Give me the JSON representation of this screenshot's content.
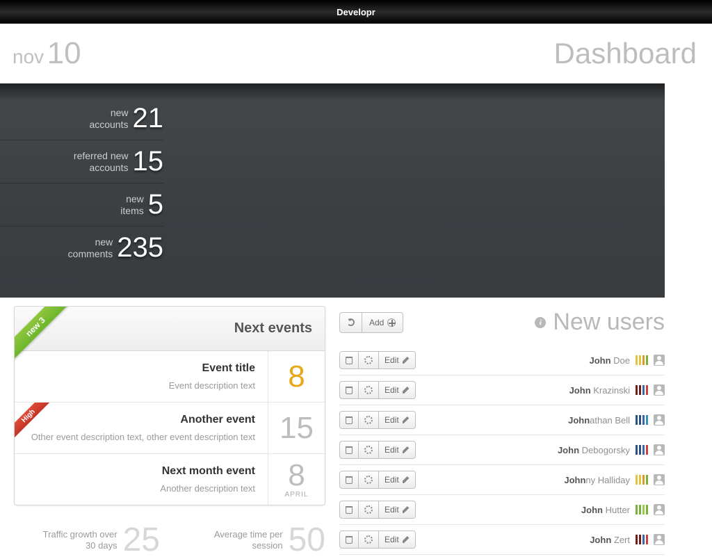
{
  "topbar": {
    "title": "Developr"
  },
  "header": {
    "month": "nov",
    "day": "10",
    "title": "Dashboard"
  },
  "stats": [
    {
      "label1": "new",
      "label2": "accounts",
      "value": "21"
    },
    {
      "label1": "referred new",
      "label2": "accounts",
      "value": "15"
    },
    {
      "label1": "new",
      "label2": "items",
      "value": "5"
    },
    {
      "label1": "new",
      "label2": "comments",
      "value": "235"
    }
  ],
  "events": {
    "header": "Next events",
    "ribbon": "new 3",
    "items": [
      {
        "title": "Event title",
        "desc": "Event description text",
        "day": "8",
        "month": "",
        "highlight": true,
        "ribbon": ""
      },
      {
        "title": "Another event",
        "desc": "Other event description text, other event description text",
        "day": "15",
        "month": "",
        "highlight": false,
        "ribbon": "High"
      },
      {
        "title": "Next month event",
        "desc": "Another description text",
        "day": "8",
        "month": "APRIL",
        "highlight": false,
        "ribbon": ""
      }
    ]
  },
  "bottom": {
    "a_label": "Traffic growth over 30 days",
    "a_value": "25",
    "b_label": "Average time per session",
    "b_value": "50"
  },
  "users": {
    "title": "New users",
    "refresh_label": "",
    "add_label": "Add",
    "edit_label": "Edit",
    "list": [
      {
        "bold": "John",
        "rest": " Doe",
        "colors": [
          "#e0c341",
          "#e0c341",
          "#d89a2b",
          "#7ab23c"
        ]
      },
      {
        "bold": "John",
        "rest": " Krazinski",
        "colors": [
          "#6f1e1e",
          "#6f1e1e",
          "#3a67a6",
          "#d04038"
        ]
      },
      {
        "bold": "John",
        "rest": "athan Bell",
        "colors": [
          "#2b4e87",
          "#2b4e87",
          "#3a67a6",
          "#3a8fbf"
        ]
      },
      {
        "bold": "John",
        "rest": " Debogorsky",
        "colors": [
          "#2b4e87",
          "#2b4e87",
          "#3a67a6",
          "#d04038"
        ]
      },
      {
        "bold": "John",
        "rest": "ny Halliday",
        "colors": [
          "#e0c341",
          "#e0c341",
          "#d89a2b",
          "#7ab23c"
        ]
      },
      {
        "bold": "John",
        "rest": " Hutter",
        "colors": [
          "#7ab23c",
          "#7ab23c",
          "#9bcc4f",
          "#7ab23c"
        ]
      },
      {
        "bold": "John",
        "rest": " Zert",
        "colors": [
          "#6f1e1e",
          "#6f1e1e",
          "#3a67a6",
          "#d04038"
        ]
      }
    ]
  }
}
